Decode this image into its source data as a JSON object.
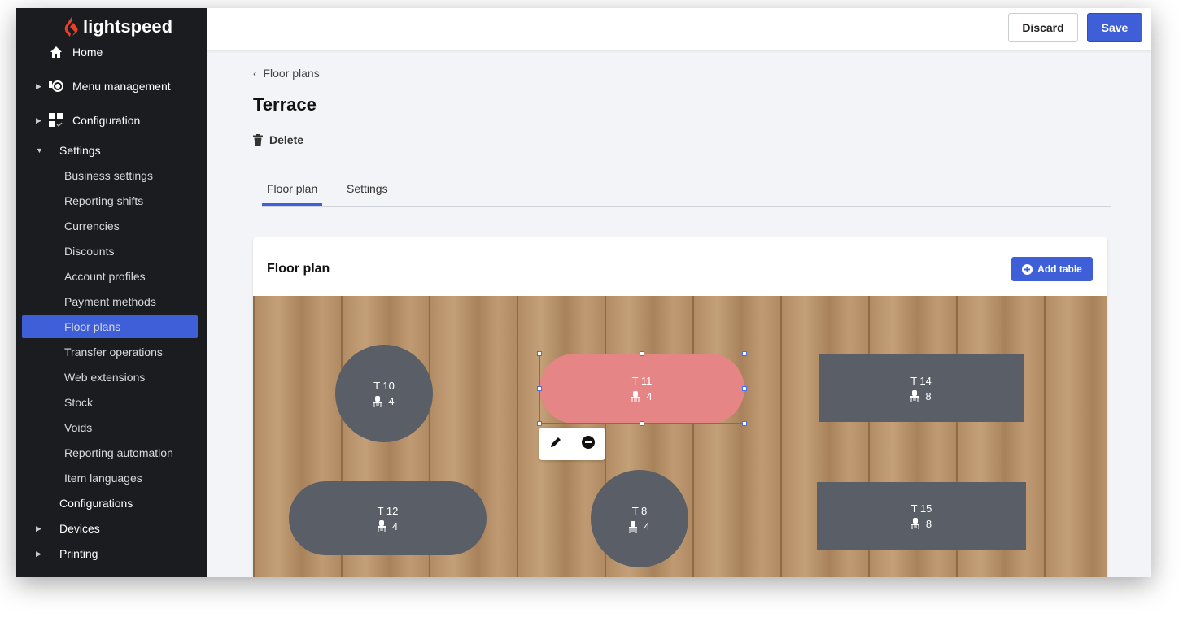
{
  "brand": {
    "name": "lightspeed",
    "color": "#e8412c"
  },
  "topbar": {
    "discard": "Discard",
    "save": "Save",
    "accent": "#3f5fd8"
  },
  "sidebar": {
    "items": [
      {
        "label": "Home",
        "icon": "home-icon"
      },
      {
        "label": "Menu management",
        "icon": "menu-icon"
      },
      {
        "label": "Configuration",
        "icon": "configuration-icon"
      },
      {
        "label": "Settings"
      },
      {
        "label": "Business settings"
      },
      {
        "label": "Reporting shifts"
      },
      {
        "label": "Currencies"
      },
      {
        "label": "Discounts"
      },
      {
        "label": "Account profiles"
      },
      {
        "label": "Payment methods"
      },
      {
        "label": "Floor plans",
        "active": true
      },
      {
        "label": "Transfer operations"
      },
      {
        "label": "Web extensions"
      },
      {
        "label": "Stock"
      },
      {
        "label": "Voids"
      },
      {
        "label": "Reporting automation"
      },
      {
        "label": "Item languages"
      },
      {
        "label": "Configurations"
      },
      {
        "label": "Devices"
      },
      {
        "label": "Printing"
      }
    ]
  },
  "page": {
    "breadcrumb": "Floor plans",
    "title": "Terrace",
    "delete": "Delete",
    "tabs": [
      "Floor plan",
      "Settings"
    ]
  },
  "card": {
    "title": "Floor plan",
    "add_table": "Add table",
    "tables": [
      {
        "name": "T 10",
        "seats": "4",
        "shape": "circle"
      },
      {
        "name": "T 11",
        "seats": "4",
        "shape": "pill",
        "selected": true,
        "color": "#e58585"
      },
      {
        "name": "T 14",
        "seats": "8",
        "shape": "rect"
      },
      {
        "name": "T 12",
        "seats": "4",
        "shape": "pill"
      },
      {
        "name": "T 8",
        "seats": "4",
        "shape": "circle"
      },
      {
        "name": "T 15",
        "seats": "8",
        "shape": "rect"
      }
    ]
  }
}
